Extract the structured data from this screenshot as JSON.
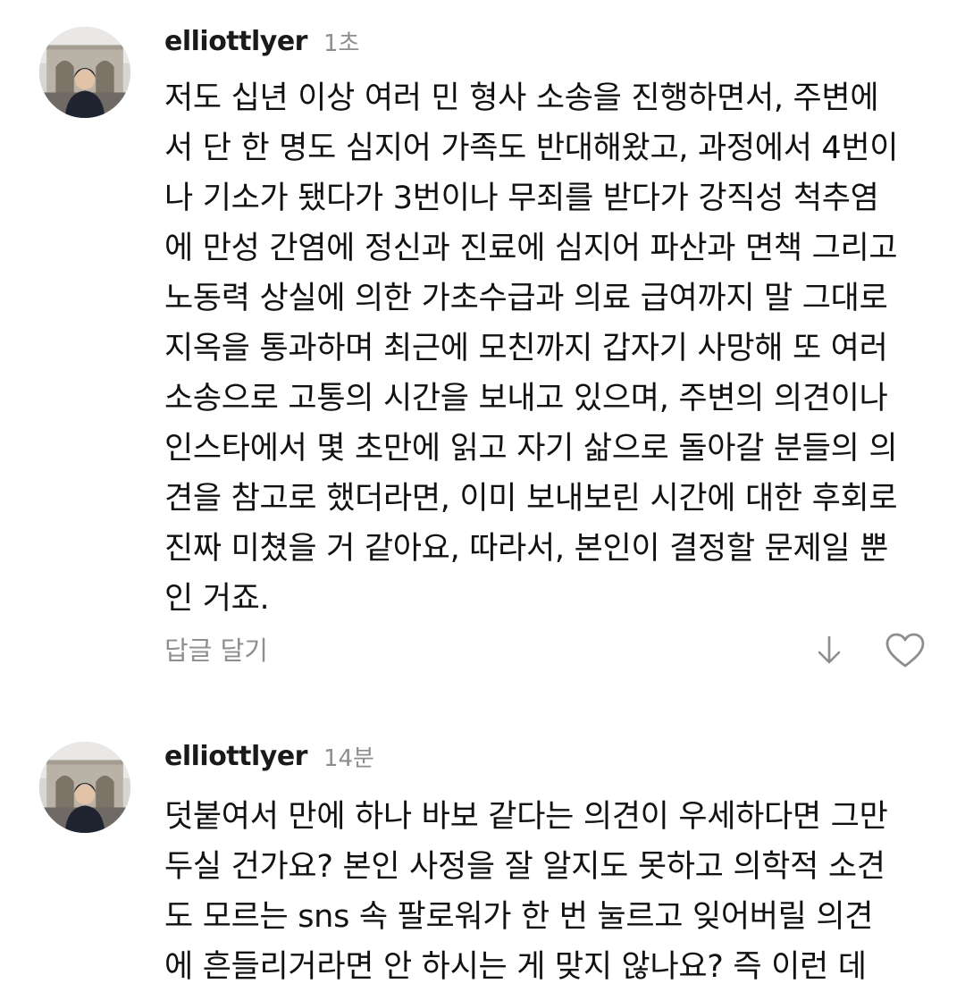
{
  "comments": [
    {
      "username": "elliottlyer",
      "time": "1초",
      "text": "저도 십년 이상 여러 민 형사 소송을 진행하면서, 주변에\n서 단 한 명도 심지어 가족도 반대해왔고, 과정에서 4번이\n나 기소가 됐다가 3번이나 무죄를 받다가 강직성 척추염\n에 만성 간염에 정신과 진료에 심지어 파산과 면책 그리고\n노동력 상실에 의한 가초수급과 의료 급여까지 말 그대로\n지옥을 통과하며 최근에 모친까지 갑자기 사망해 또 여러\n소송으로 고통의 시간을 보내고 있으며, 주변의 의견이나\n인스타에서 몇 초만에 읽고 자기 삶으로 돌아갈 분들의 의\n견을 참고로 했더라면, 이미 보내보린 시간에 대한 후회로\n진짜 미쳤을 거 같아요, 따라서, 본인이 결정할 문제일 뿐\n인 거죠.",
      "reply_label": "답글 달기",
      "icons": {
        "down": "arrow-down-icon",
        "like": "heart-icon"
      }
    },
    {
      "username": "elliottlyer",
      "time": "14분",
      "text": "덧붙여서 만에 하나 바보 같다는 의견이 우세하다면 그만\n두실 건가요? 본인 사정을 잘 알지도 못하고 의학적 소견\n도 모르는 sns 속 팔로워가 한 번 눌르고 잊어버릴 의견\n에 흔들리거라면 안 하시는 게 맞지 않나요? 즉 이런 데"
    }
  ],
  "colors": {
    "text": "#111111",
    "muted": "#8e8e8e",
    "background": "#ffffff"
  }
}
